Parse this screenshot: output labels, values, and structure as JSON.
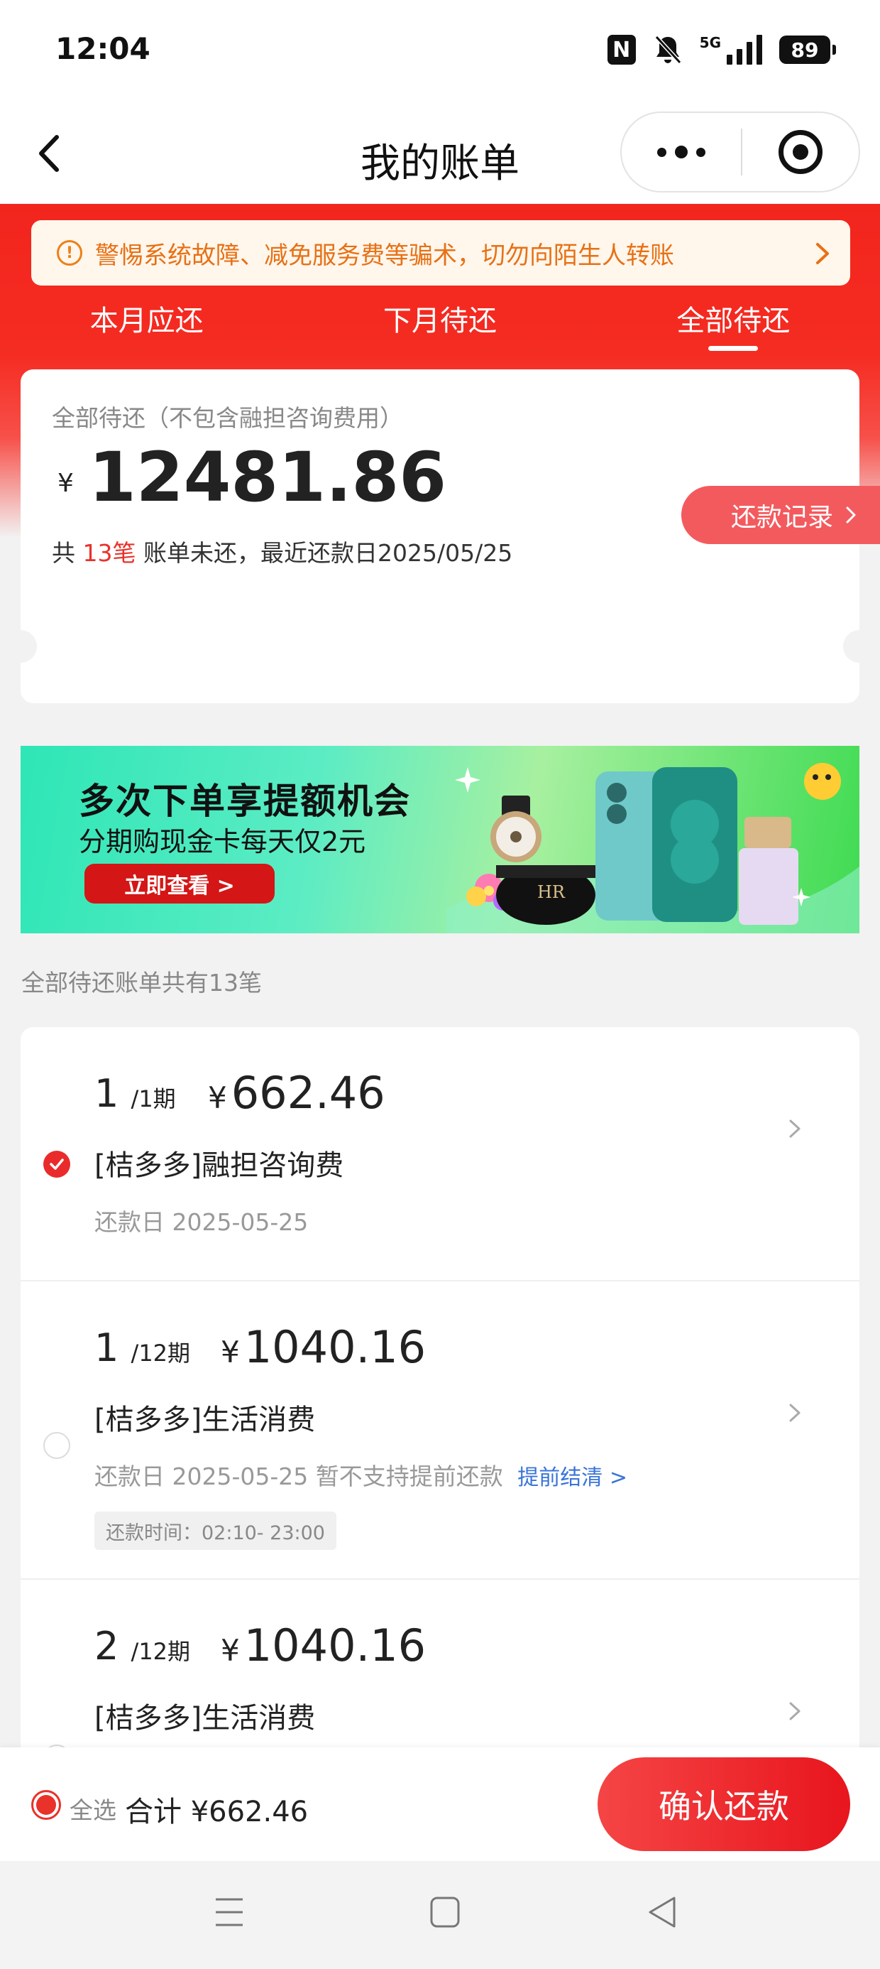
{
  "status_bar": {
    "time": "12:04",
    "nfc": "N",
    "network": "5G",
    "battery": "89",
    "icons": [
      "nfc-icon",
      "bell-off-icon",
      "signal-icon",
      "battery-icon"
    ]
  },
  "nav": {
    "title": "我的账单",
    "icons": [
      "back-icon",
      "more-icon",
      "close-target-icon"
    ]
  },
  "warning": {
    "text": "警惕系统故障、减免服务费等骗术，切勿向陌生人转账",
    "icon": "!",
    "color": "#e77115"
  },
  "tabs": [
    {
      "label": "本月应还",
      "active": false
    },
    {
      "label": "下月待还",
      "active": false
    },
    {
      "label": "全部待还",
      "active": true
    }
  ],
  "summary": {
    "label": "全部待还（不包含融担咨询费用）",
    "currency": "¥",
    "amount": "12481.86",
    "sub_prefix": "共 ",
    "sub_count": "13笔",
    "sub_suffix": " 账单未还，最近还款日2025/05/25",
    "record_button": "还款记录"
  },
  "promo": {
    "title": "多次下单享提额机会",
    "subtitle": "分期购现金卡每天仅2元",
    "cta": "立即查看 >"
  },
  "list_caption": "全部待还账单共有13笔",
  "bills": [
    {
      "period_num": "1",
      "period_total": "/1期",
      "currency": "¥",
      "amount": "662.46",
      "name": "[桔多多]融担咨询费",
      "date": "还款日 2025-05-25",
      "checked": true
    },
    {
      "period_num": "1",
      "period_total": "/12期",
      "currency": "¥",
      "amount": "1040.16",
      "name": "[桔多多]生活消费",
      "date": "还款日 2025-05-25",
      "note": "暂不支持提前还款",
      "link": "提前结清 >",
      "time_tag": "还款时间：02:10- 23:00",
      "checked": false
    },
    {
      "period_num": "2",
      "period_total": "/12期",
      "currency": "¥",
      "amount": "1040.16",
      "name": "[桔多多]生活消费",
      "checked": false
    }
  ],
  "pay_bar": {
    "select_all": "全选",
    "total": "合计 ¥662.46",
    "confirm": "确认还款"
  },
  "colors": {
    "brand_red": "#f2251d",
    "accent_red": "#e8322a",
    "link_blue": "#3a74d8"
  }
}
